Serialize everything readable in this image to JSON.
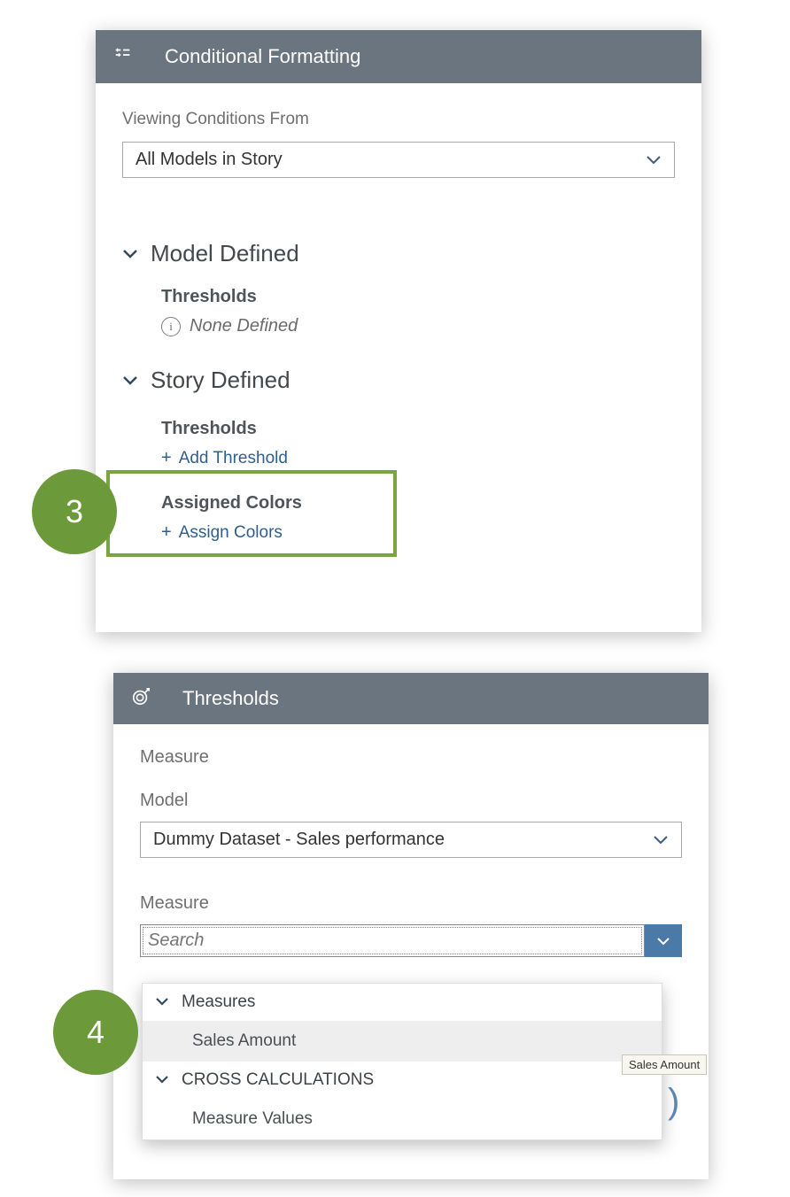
{
  "panel1": {
    "title": "Conditional Formatting",
    "viewing_from_label": "Viewing Conditions From",
    "viewing_from_value": "All Models in Story",
    "model_defined": "Model Defined",
    "thresholds_label": "Thresholds",
    "none_defined": "None Defined",
    "story_defined": "Story Defined",
    "add_threshold": "Add Threshold",
    "assigned_colors": "Assigned Colors",
    "assign_colors": "Assign Colors"
  },
  "step3": "3",
  "panel2": {
    "title": "Thresholds",
    "measure_heading": "Measure",
    "model_label": "Model",
    "model_value": "Dummy Dataset - Sales performance",
    "measure_label": "Measure",
    "search_placeholder": "Search",
    "group_measures": "Measures",
    "item_sales_amount": "Sales Amount",
    "group_cross": "CROSS CALCULATIONS",
    "item_measure_values": "Measure Values"
  },
  "step4": "4",
  "tooltip": "Sales Amount"
}
